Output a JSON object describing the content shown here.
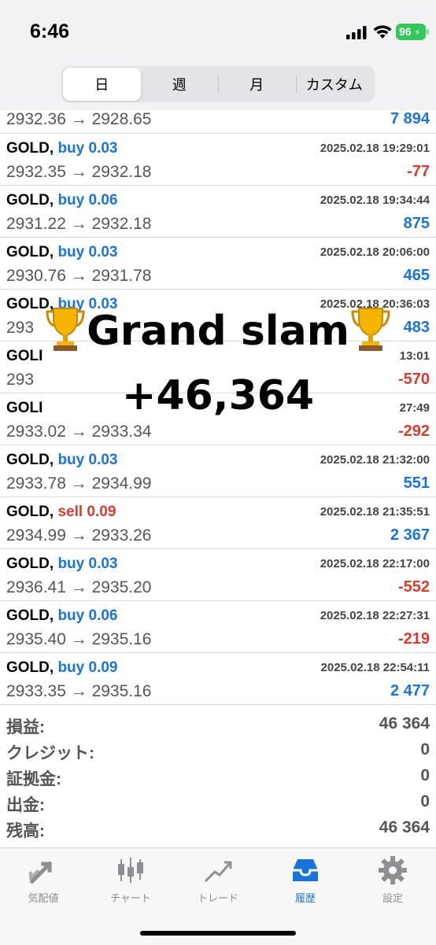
{
  "status": {
    "time": "6:46",
    "battery": "96"
  },
  "segmented": [
    "日",
    "週",
    "月",
    "カスタム"
  ],
  "partial_row": {
    "price": "2932.36 → 2928.65",
    "profit": "7 894"
  },
  "trades": [
    {
      "symbol": "GOLD,",
      "dir": "buy 0.03",
      "type": "buy",
      "datetime": "2025.02.18 19:29:01",
      "price": "2932.35 → 2932.18",
      "profit": "-77",
      "sign": "neg"
    },
    {
      "symbol": "GOLD,",
      "dir": "buy 0.06",
      "type": "buy",
      "datetime": "2025.02.18 19:34:44",
      "price": "2931.22 → 2932.18",
      "profit": "875",
      "sign": "pos"
    },
    {
      "symbol": "GOLD,",
      "dir": "buy 0.03",
      "type": "buy",
      "datetime": "2025.02.18 20:06:00",
      "price": "2930.76 → 2931.78",
      "profit": "465",
      "sign": "pos"
    },
    {
      "symbol": "GOLD,",
      "dir": "buy 0.03",
      "type": "buy",
      "datetime": "2025.02.18 20:36:03",
      "price": "293",
      "profit": "483",
      "sign": "pos"
    },
    {
      "symbol": "GOLI",
      "dir": "",
      "type": "buy",
      "datetime": "13:01",
      "price": "293",
      "profit": "-570",
      "sign": "neg"
    },
    {
      "symbol": "GOLI",
      "dir": "",
      "type": "buy",
      "datetime": "27:49",
      "price": "2933.02 → 2933.34",
      "profit": "-292",
      "sign": "neg"
    },
    {
      "symbol": "GOLD,",
      "dir": "buy 0.03",
      "type": "buy",
      "datetime": "2025.02.18 21:32:00",
      "price": "2933.78 → 2934.99",
      "profit": "551",
      "sign": "pos"
    },
    {
      "symbol": "GOLD,",
      "dir": "sell 0.09",
      "type": "sell",
      "datetime": "2025.02.18 21:35:51",
      "price": "2934.99 → 2933.26",
      "profit": "2 367",
      "sign": "pos"
    },
    {
      "symbol": "GOLD,",
      "dir": "buy 0.03",
      "type": "buy",
      "datetime": "2025.02.18 22:17:00",
      "price": "2936.41 → 2935.20",
      "profit": "-552",
      "sign": "neg"
    },
    {
      "symbol": "GOLD,",
      "dir": "buy 0.06",
      "type": "buy",
      "datetime": "2025.02.18 22:27:31",
      "price": "2935.40 → 2935.16",
      "profit": "-219",
      "sign": "neg"
    },
    {
      "symbol": "GOLD,",
      "dir": "buy 0.09",
      "type": "buy",
      "datetime": "2025.02.18 22:54:11",
      "price": "2933.35 → 2935.16",
      "profit": "2 477",
      "sign": "pos"
    }
  ],
  "summary": [
    {
      "label": "損益:",
      "value": "46 364"
    },
    {
      "label": "クレジット:",
      "value": "0"
    },
    {
      "label": "証拠金:",
      "value": "0"
    },
    {
      "label": "出金:",
      "value": "0"
    },
    {
      "label": "残高:",
      "value": "46 364"
    }
  ],
  "overlay": {
    "line1": "Grand slam",
    "line2": "+46,364"
  },
  "tabs": [
    {
      "label": "気配値",
      "icon": "quotes-arrows-icon",
      "active": false
    },
    {
      "label": "チャート",
      "icon": "candlestick-chart-icon",
      "active": false
    },
    {
      "label": "トレード",
      "icon": "trade-line-icon",
      "active": false
    },
    {
      "label": "履歴",
      "icon": "history-tray-icon",
      "active": true
    },
    {
      "label": "設定",
      "icon": "gear-icon",
      "active": false
    }
  ],
  "colors": {
    "buy": "#1a73d9",
    "sell": "#d93b2f",
    "battery": "#34c759"
  }
}
